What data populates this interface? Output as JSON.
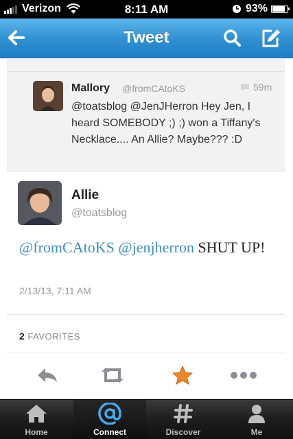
{
  "status_bar": {
    "carrier": "Verizon",
    "time": "8:11 AM",
    "battery": "93%",
    "battery_level": 0.93
  },
  "nav": {
    "title": "Tweet"
  },
  "quoted_tweet": {
    "cut_off_text": "...",
    "name": "Mallory",
    "handle": "@fromCAtoKS",
    "time": "59m",
    "text": "@toatsblog @JenJHerron Hey Jen, I heard SOMEBODY ;) ;) won a Tiffany's Necklace.... An Allie? Maybe??? :D"
  },
  "tweet": {
    "name": "Allie",
    "handle": "@toatsblog",
    "mention1": "@fromCAtoKS",
    "mention2": "@jenjherron",
    "text": "SHUT UP!",
    "date": "2/13/13, 7:11 AM",
    "favorites_count": "2",
    "favorites_label": "FAVORITES"
  },
  "actions": {
    "reply": "reply-icon",
    "retweet": "retweet-icon",
    "favorite": "star-icon",
    "more": "more-icon"
  },
  "tabs": [
    {
      "label": "Home",
      "icon": "home-icon"
    },
    {
      "label": "Connect",
      "icon": "at-icon"
    },
    {
      "label": "Discover",
      "icon": "hashtag-icon"
    },
    {
      "label": "Me",
      "icon": "person-icon"
    }
  ],
  "colors": {
    "accent": "#3d8bc6",
    "nav_blue": "#2f8fd2",
    "star": "#f0862b"
  }
}
